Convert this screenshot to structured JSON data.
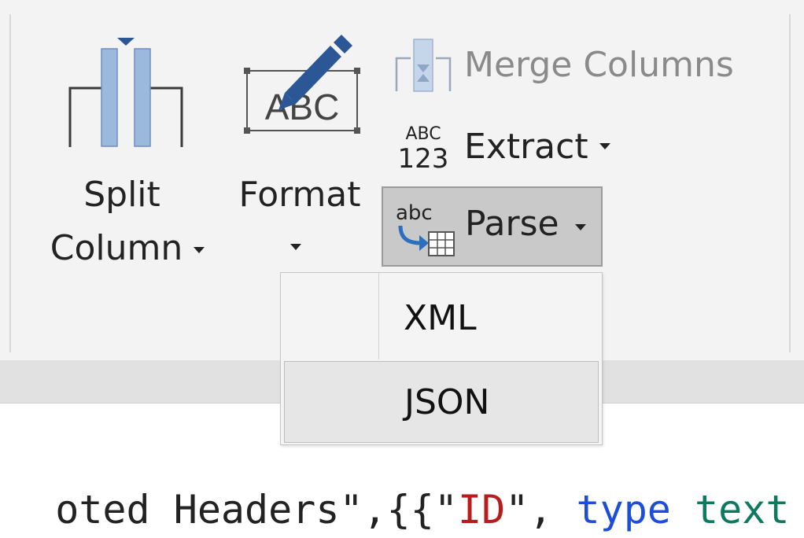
{
  "ribbon": {
    "split_column": {
      "line1": "Split",
      "line2": "Column",
      "icon": "split-column-icon"
    },
    "format": {
      "label": "Format",
      "icon": "format-abc-icon"
    },
    "merge_columns": {
      "label": "Merge Columns",
      "icon": "merge-columns-icon",
      "state": "disabled"
    },
    "extract": {
      "label": "Extract",
      "icon": "abc-123-icon"
    },
    "parse": {
      "label": "Parse",
      "icon": "parse-icon",
      "state": "pressed"
    }
  },
  "parse_menu": {
    "items": [
      {
        "label": "XML"
      },
      {
        "label": "JSON",
        "highlighted": true
      }
    ]
  },
  "formula_snippet": {
    "segments": [
      {
        "text": "oted Headers\",{{\"",
        "color": "#222222"
      },
      {
        "text": "ID",
        "color": "#b91c1c"
      },
      {
        "text": "\", ",
        "color": "#222222"
      },
      {
        "text": "type ",
        "color": "#1d4ed8"
      },
      {
        "text": "text",
        "color": "#0d7a5f"
      }
    ]
  },
  "colors": {
    "ribbon_bg": "#f3f3f3",
    "icon_blue": "#9bb8dd",
    "pen_blue": "#2b5797",
    "pressed_bg": "#c9c9c9",
    "menu_bg": "#f4f4f4"
  }
}
